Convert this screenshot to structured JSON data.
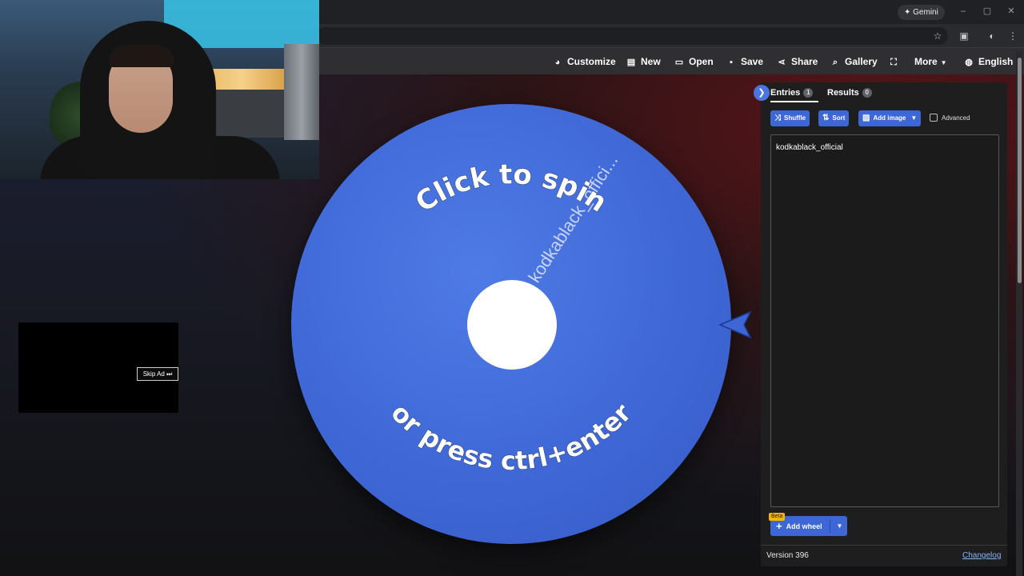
{
  "browser": {
    "gemini_label": "✦ Gemini",
    "window_buttons": [
      "–",
      "▢",
      "✕"
    ],
    "address_icons": [
      "star-icon",
      "sidebar-icon",
      "extensions-icon",
      "menu-icon"
    ]
  },
  "nav": {
    "customize": "Customize",
    "new": "New",
    "open": "Open",
    "save": "Save",
    "share": "Share",
    "gallery": "Gallery",
    "more": "More",
    "language": "English"
  },
  "wheel": {
    "entry_label": "kodkablack_offici...",
    "prompt_top": "Click to spin",
    "prompt_bottom": "or press ctrl+enter",
    "color": "#3f68d6"
  },
  "ad": {
    "skip_label": "Skip Ad ⏭"
  },
  "panel": {
    "tabs": [
      {
        "label": "Entries",
        "count": "1"
      },
      {
        "label": "Results",
        "count": "0"
      }
    ],
    "buttons": {
      "shuffle": "Shuffle",
      "sort": "Sort",
      "add_image": "Add image",
      "advanced": "Advanced"
    },
    "entries": [
      "kodkablack_official"
    ],
    "beta": "Beta",
    "add_wheel": "Add wheel",
    "version": "Version 396",
    "changelog": "Changelog"
  }
}
